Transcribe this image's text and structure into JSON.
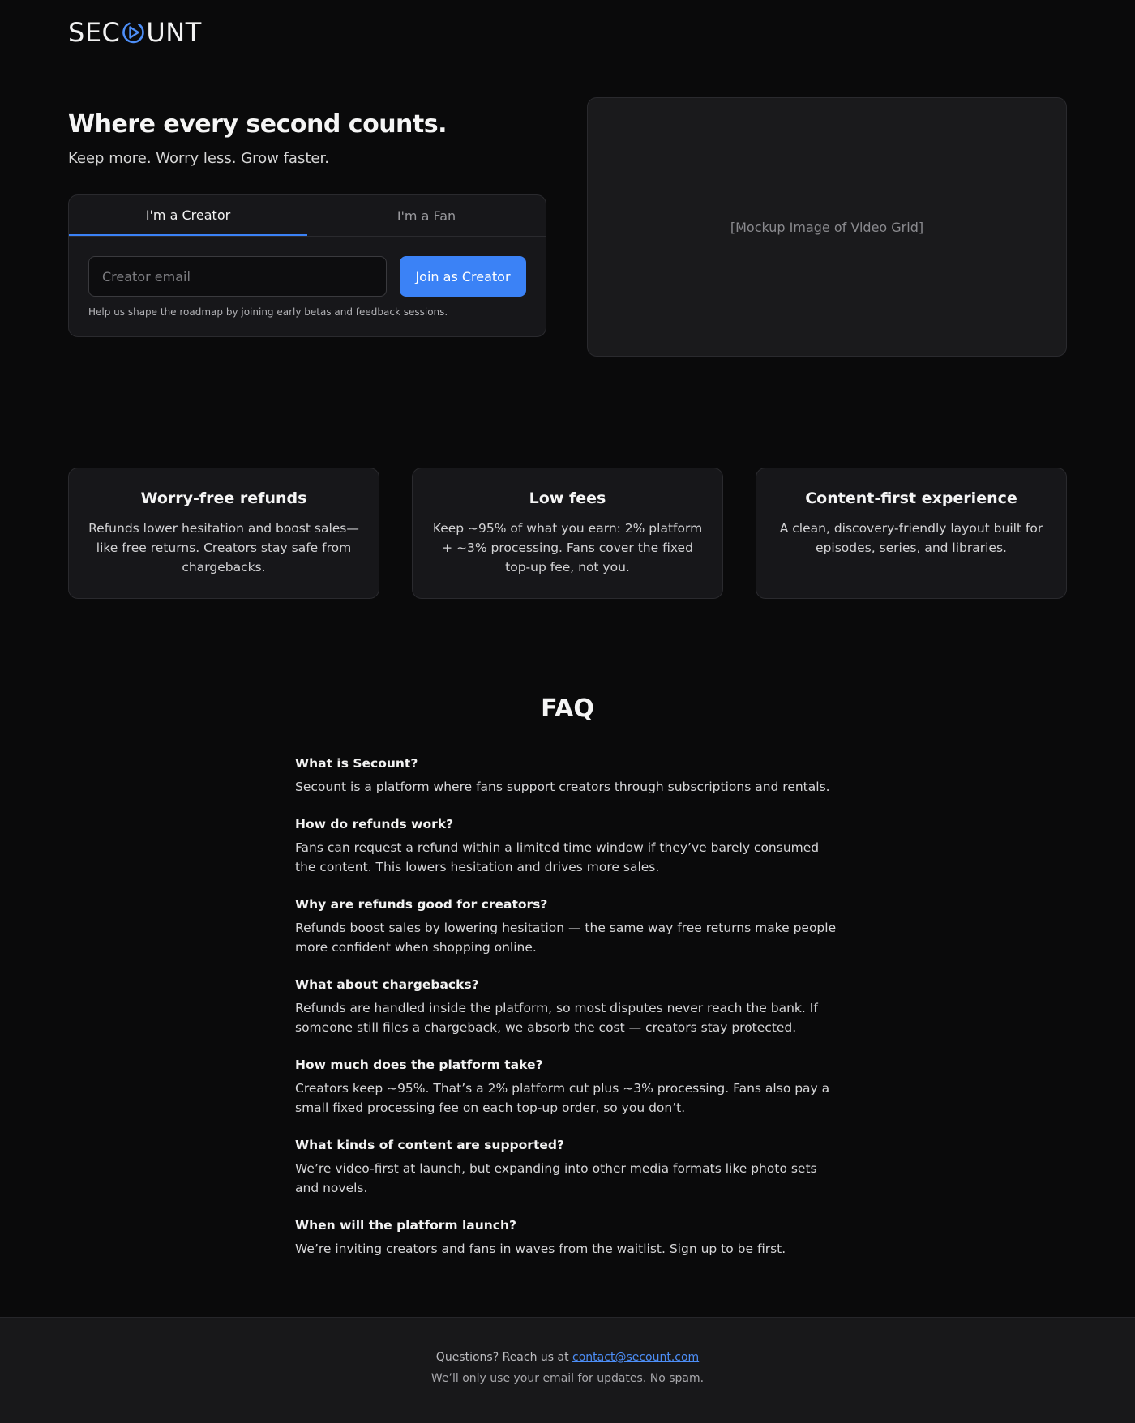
{
  "brand": {
    "logo_left": "SEC",
    "logo_right": "UNT",
    "accent_color": "#3b82f6"
  },
  "hero": {
    "title": "Where every second counts.",
    "subtitle": "Keep more. Worry less. Grow faster.",
    "tabs": [
      {
        "label": "I'm a Creator",
        "active": true
      },
      {
        "label": "I'm a Fan",
        "active": false
      }
    ],
    "email_placeholder": "Creator email",
    "email_value": "",
    "join_label": "Join as Creator",
    "hint": "Help us shape the roadmap by joining early betas and feedback sessions.",
    "mockup_label": "[Mockup Image of Video Grid]"
  },
  "features": [
    {
      "title": "Worry-free refunds",
      "body": "Refunds lower hesitation and boost sales—like free returns. Creators stay safe from chargebacks."
    },
    {
      "title": "Low fees",
      "body": "Keep ~95% of what you earn: 2% platform + ~3% processing. Fans cover the fixed top-up fee, not you."
    },
    {
      "title": "Content-first experience",
      "body": "A clean, discovery-friendly layout built for episodes, series, and libraries."
    }
  ],
  "faq": {
    "title": "FAQ",
    "items": [
      {
        "q": "What is Secount?",
        "a": "Secount is a platform where fans support creators through subscriptions and rentals."
      },
      {
        "q": "How do refunds work?",
        "a": "Fans can request a refund within a limited time window if they’ve barely consumed the content. This lowers hesitation and drives more sales."
      },
      {
        "q": "Why are refunds good for creators?",
        "a": "Refunds boost sales by lowering hesitation — the same way free returns make people more confident when shopping online."
      },
      {
        "q": "What about chargebacks?",
        "a": "Refunds are handled inside the platform, so most disputes never reach the bank. If someone still files a chargeback, we absorb the cost — creators stay protected."
      },
      {
        "q": "How much does the platform take?",
        "a": "Creators keep ~95%. That’s a 2% platform cut plus ~3% processing. Fans also pay a small fixed processing fee on each top-up order, so you don’t."
      },
      {
        "q": "What kinds of content are supported?",
        "a": "We’re video-first at launch, but expanding into other media formats like photo sets and novels."
      },
      {
        "q": "When will the platform launch?",
        "a": "We’re inviting creators and fans in waves from the waitlist. Sign up to be first."
      }
    ]
  },
  "footer": {
    "question_text": "Questions? Reach us at ",
    "email_link": "contact@secount.com",
    "privacy_note": "We’ll only use your email for updates. No spam."
  }
}
